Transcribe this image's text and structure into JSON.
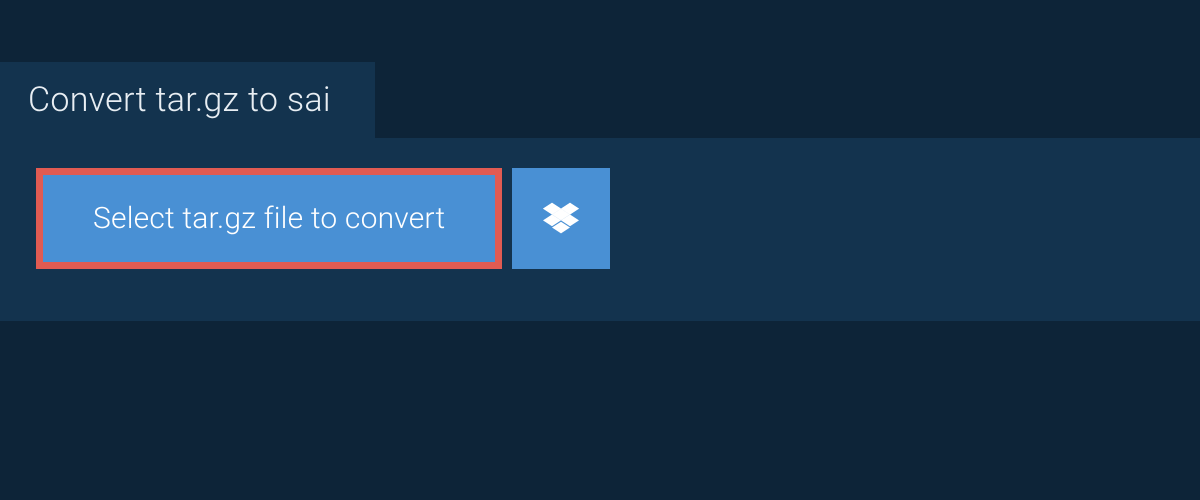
{
  "tab": {
    "title": "Convert tar.gz to sai"
  },
  "actions": {
    "select_file_label": "Select tar.gz file to convert",
    "dropbox_icon": "dropbox-icon"
  }
}
